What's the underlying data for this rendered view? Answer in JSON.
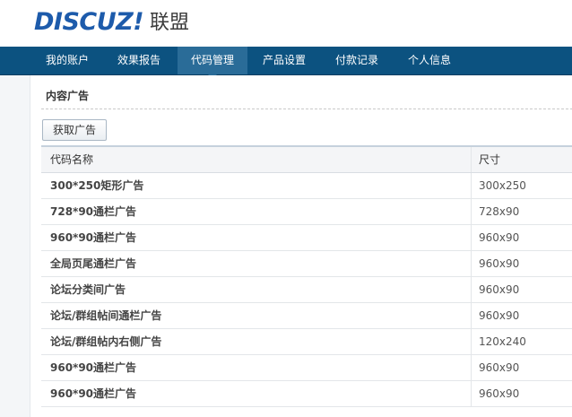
{
  "logo": {
    "brand": "DISCUZ!",
    "sub": "联盟"
  },
  "nav": {
    "items": [
      {
        "label": "我的账户",
        "active": false
      },
      {
        "label": "效果报告",
        "active": false
      },
      {
        "label": "代码管理",
        "active": true
      },
      {
        "label": "产品设置",
        "active": false
      },
      {
        "label": "付款记录",
        "active": false
      },
      {
        "label": "个人信息",
        "active": false
      }
    ]
  },
  "main": {
    "section_title": "内容广告",
    "get_button": "获取广告",
    "table": {
      "headers": [
        "代码名称",
        "尺寸"
      ],
      "rows": [
        [
          "300*250矩形广告",
          "300x250"
        ],
        [
          "728*90通栏广告",
          "728x90"
        ],
        [
          "960*90通栏广告",
          "960x90"
        ],
        [
          "全局页尾通栏广告",
          "960x90"
        ],
        [
          "论坛分类间广告",
          "960x90"
        ],
        [
          "论坛/群组帖间通栏广告",
          "960x90"
        ],
        [
          "论坛/群组帖内右侧广告",
          "120x240"
        ],
        [
          "960*90通栏广告",
          "960x90"
        ],
        [
          "960*90通栏广告",
          "960x90"
        ]
      ]
    }
  },
  "colors": {
    "brand_blue": "#1d5bab",
    "nav_bg": "#0c5280",
    "nav_active": "#2a6c98"
  }
}
